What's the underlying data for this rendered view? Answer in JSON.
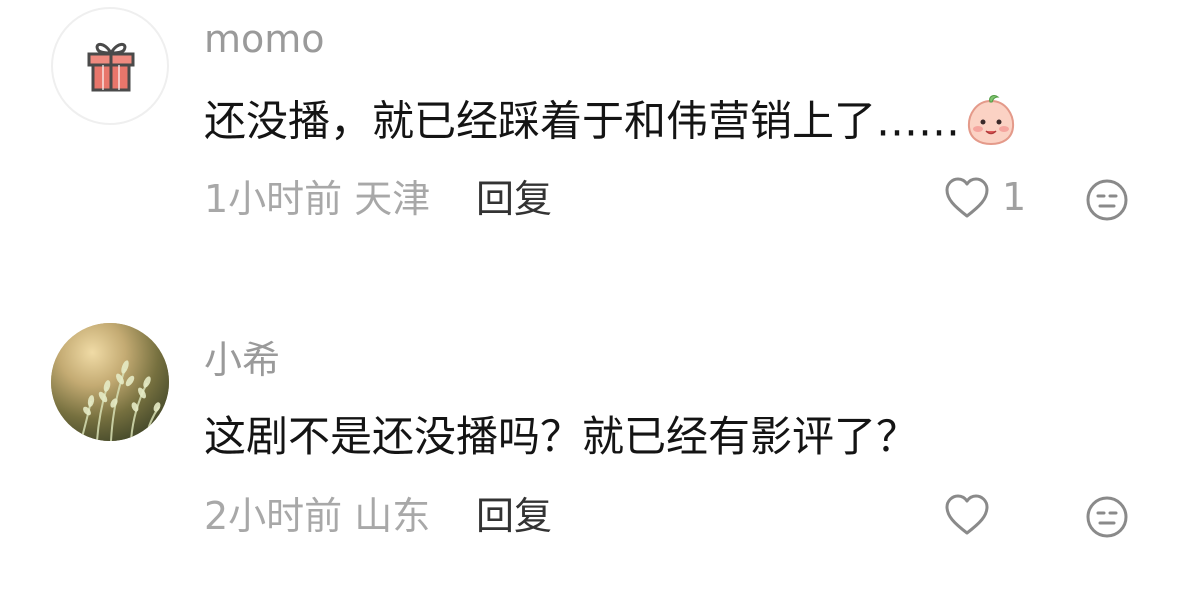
{
  "comments": [
    {
      "username": "momo",
      "avatar_icon": "gift-icon",
      "text": "还没播，就已经踩着于和伟营销上了……",
      "sticker_icon": "peach-smile-emoji",
      "time": "1小时前",
      "location": "天津",
      "reply_label": "回复",
      "like_count": "1"
    },
    {
      "username": "小希",
      "avatar_icon": "grass-photo-avatar",
      "text": "这剧不是还没播吗？就已经有影评了？",
      "time": "2小时前",
      "location": "山东",
      "reply_label": "回复",
      "like_count": ""
    }
  ],
  "colors": {
    "username": "#9a9a9a",
    "text": "#141414",
    "meta": "#a8a8a8",
    "reply": "#333333",
    "gift": "#e8766b"
  }
}
